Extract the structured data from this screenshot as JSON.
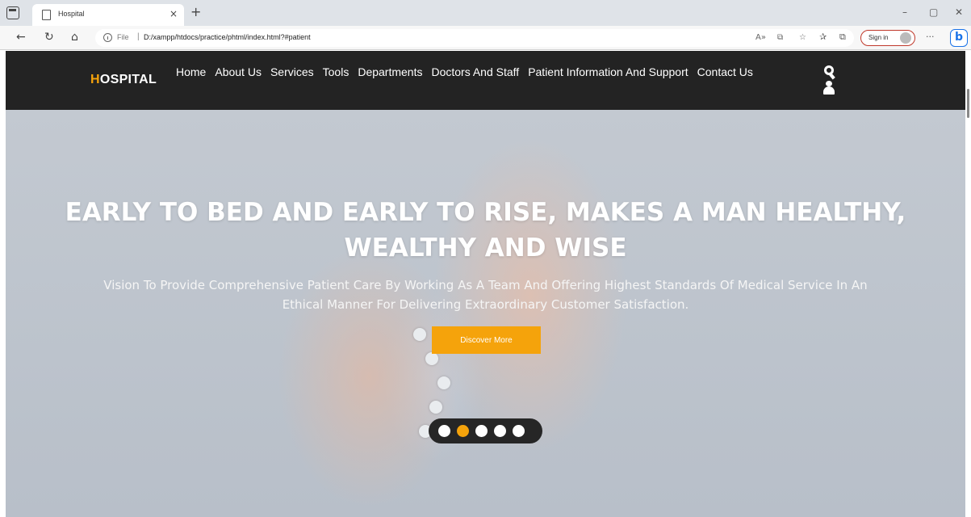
{
  "browser": {
    "tab_title": "Hospital",
    "tab_close": "×",
    "new_tab": "+",
    "window_controls": {
      "minimize": "–",
      "maximize": "▢",
      "close": "✕"
    },
    "nav": {
      "back": "←",
      "refresh": "↻",
      "home": "⌂"
    },
    "address": {
      "file_label": "File",
      "separator": "|",
      "url": "D:/xampp/htdocs/practice/phtml/index.html?#patient"
    },
    "signin_label": "Sign in",
    "more": "···",
    "copilot": "b"
  },
  "site": {
    "logo": {
      "accent": "H",
      "rest": "OSPITAL",
      "accent_color": "#f5a30b"
    },
    "nav": [
      "Home",
      "About Us",
      "Services",
      "Tools",
      "Departments",
      "Doctors And Staff",
      "Patient Information And Support",
      "Contact Us"
    ],
    "header_bg": "#232323"
  },
  "hero": {
    "title": "EARLY TO BED AND EARLY TO RISE, MAKES A MAN HEALTHY, WEALTHY AND WISE",
    "subtitle": "Vision To Provide Comprehensive Patient Care By Working As A Team And Offering Highest Standards Of Medical Service In An Ethical Manner For Delivering Extraordinary Customer Satisfaction.",
    "cta_label": "Discover More",
    "cta_color": "#f5a30b",
    "slides": {
      "count": 5,
      "active": 2
    }
  }
}
